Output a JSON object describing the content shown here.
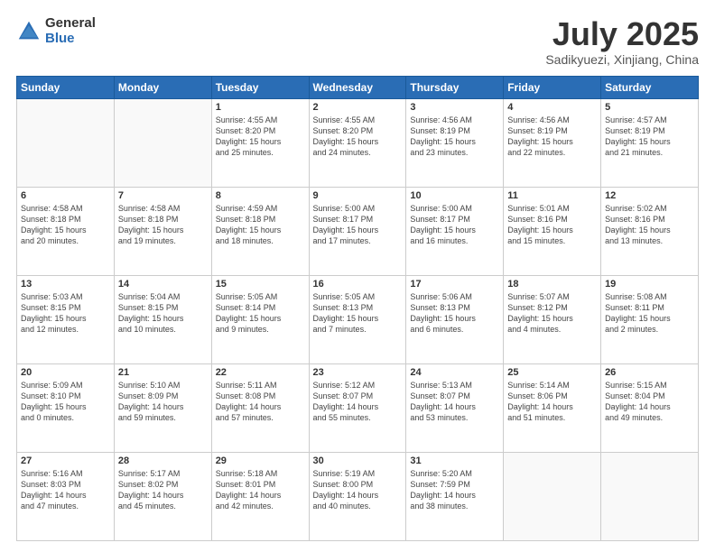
{
  "header": {
    "logo_general": "General",
    "logo_blue": "Blue",
    "month_title": "July 2025",
    "subtitle": "Sadikyuezi, Xinjiang, China"
  },
  "days_of_week": [
    "Sunday",
    "Monday",
    "Tuesday",
    "Wednesday",
    "Thursday",
    "Friday",
    "Saturday"
  ],
  "weeks": [
    [
      {
        "day": "",
        "text": ""
      },
      {
        "day": "",
        "text": ""
      },
      {
        "day": "1",
        "text": "Sunrise: 4:55 AM\nSunset: 8:20 PM\nDaylight: 15 hours\nand 25 minutes."
      },
      {
        "day": "2",
        "text": "Sunrise: 4:55 AM\nSunset: 8:20 PM\nDaylight: 15 hours\nand 24 minutes."
      },
      {
        "day": "3",
        "text": "Sunrise: 4:56 AM\nSunset: 8:19 PM\nDaylight: 15 hours\nand 23 minutes."
      },
      {
        "day": "4",
        "text": "Sunrise: 4:56 AM\nSunset: 8:19 PM\nDaylight: 15 hours\nand 22 minutes."
      },
      {
        "day": "5",
        "text": "Sunrise: 4:57 AM\nSunset: 8:19 PM\nDaylight: 15 hours\nand 21 minutes."
      }
    ],
    [
      {
        "day": "6",
        "text": "Sunrise: 4:58 AM\nSunset: 8:18 PM\nDaylight: 15 hours\nand 20 minutes."
      },
      {
        "day": "7",
        "text": "Sunrise: 4:58 AM\nSunset: 8:18 PM\nDaylight: 15 hours\nand 19 minutes."
      },
      {
        "day": "8",
        "text": "Sunrise: 4:59 AM\nSunset: 8:18 PM\nDaylight: 15 hours\nand 18 minutes."
      },
      {
        "day": "9",
        "text": "Sunrise: 5:00 AM\nSunset: 8:17 PM\nDaylight: 15 hours\nand 17 minutes."
      },
      {
        "day": "10",
        "text": "Sunrise: 5:00 AM\nSunset: 8:17 PM\nDaylight: 15 hours\nand 16 minutes."
      },
      {
        "day": "11",
        "text": "Sunrise: 5:01 AM\nSunset: 8:16 PM\nDaylight: 15 hours\nand 15 minutes."
      },
      {
        "day": "12",
        "text": "Sunrise: 5:02 AM\nSunset: 8:16 PM\nDaylight: 15 hours\nand 13 minutes."
      }
    ],
    [
      {
        "day": "13",
        "text": "Sunrise: 5:03 AM\nSunset: 8:15 PM\nDaylight: 15 hours\nand 12 minutes."
      },
      {
        "day": "14",
        "text": "Sunrise: 5:04 AM\nSunset: 8:15 PM\nDaylight: 15 hours\nand 10 minutes."
      },
      {
        "day": "15",
        "text": "Sunrise: 5:05 AM\nSunset: 8:14 PM\nDaylight: 15 hours\nand 9 minutes."
      },
      {
        "day": "16",
        "text": "Sunrise: 5:05 AM\nSunset: 8:13 PM\nDaylight: 15 hours\nand 7 minutes."
      },
      {
        "day": "17",
        "text": "Sunrise: 5:06 AM\nSunset: 8:13 PM\nDaylight: 15 hours\nand 6 minutes."
      },
      {
        "day": "18",
        "text": "Sunrise: 5:07 AM\nSunset: 8:12 PM\nDaylight: 15 hours\nand 4 minutes."
      },
      {
        "day": "19",
        "text": "Sunrise: 5:08 AM\nSunset: 8:11 PM\nDaylight: 15 hours\nand 2 minutes."
      }
    ],
    [
      {
        "day": "20",
        "text": "Sunrise: 5:09 AM\nSunset: 8:10 PM\nDaylight: 15 hours\nand 0 minutes."
      },
      {
        "day": "21",
        "text": "Sunrise: 5:10 AM\nSunset: 8:09 PM\nDaylight: 14 hours\nand 59 minutes."
      },
      {
        "day": "22",
        "text": "Sunrise: 5:11 AM\nSunset: 8:08 PM\nDaylight: 14 hours\nand 57 minutes."
      },
      {
        "day": "23",
        "text": "Sunrise: 5:12 AM\nSunset: 8:07 PM\nDaylight: 14 hours\nand 55 minutes."
      },
      {
        "day": "24",
        "text": "Sunrise: 5:13 AM\nSunset: 8:07 PM\nDaylight: 14 hours\nand 53 minutes."
      },
      {
        "day": "25",
        "text": "Sunrise: 5:14 AM\nSunset: 8:06 PM\nDaylight: 14 hours\nand 51 minutes."
      },
      {
        "day": "26",
        "text": "Sunrise: 5:15 AM\nSunset: 8:04 PM\nDaylight: 14 hours\nand 49 minutes."
      }
    ],
    [
      {
        "day": "27",
        "text": "Sunrise: 5:16 AM\nSunset: 8:03 PM\nDaylight: 14 hours\nand 47 minutes."
      },
      {
        "day": "28",
        "text": "Sunrise: 5:17 AM\nSunset: 8:02 PM\nDaylight: 14 hours\nand 45 minutes."
      },
      {
        "day": "29",
        "text": "Sunrise: 5:18 AM\nSunset: 8:01 PM\nDaylight: 14 hours\nand 42 minutes."
      },
      {
        "day": "30",
        "text": "Sunrise: 5:19 AM\nSunset: 8:00 PM\nDaylight: 14 hours\nand 40 minutes."
      },
      {
        "day": "31",
        "text": "Sunrise: 5:20 AM\nSunset: 7:59 PM\nDaylight: 14 hours\nand 38 minutes."
      },
      {
        "day": "",
        "text": ""
      },
      {
        "day": "",
        "text": ""
      }
    ]
  ]
}
